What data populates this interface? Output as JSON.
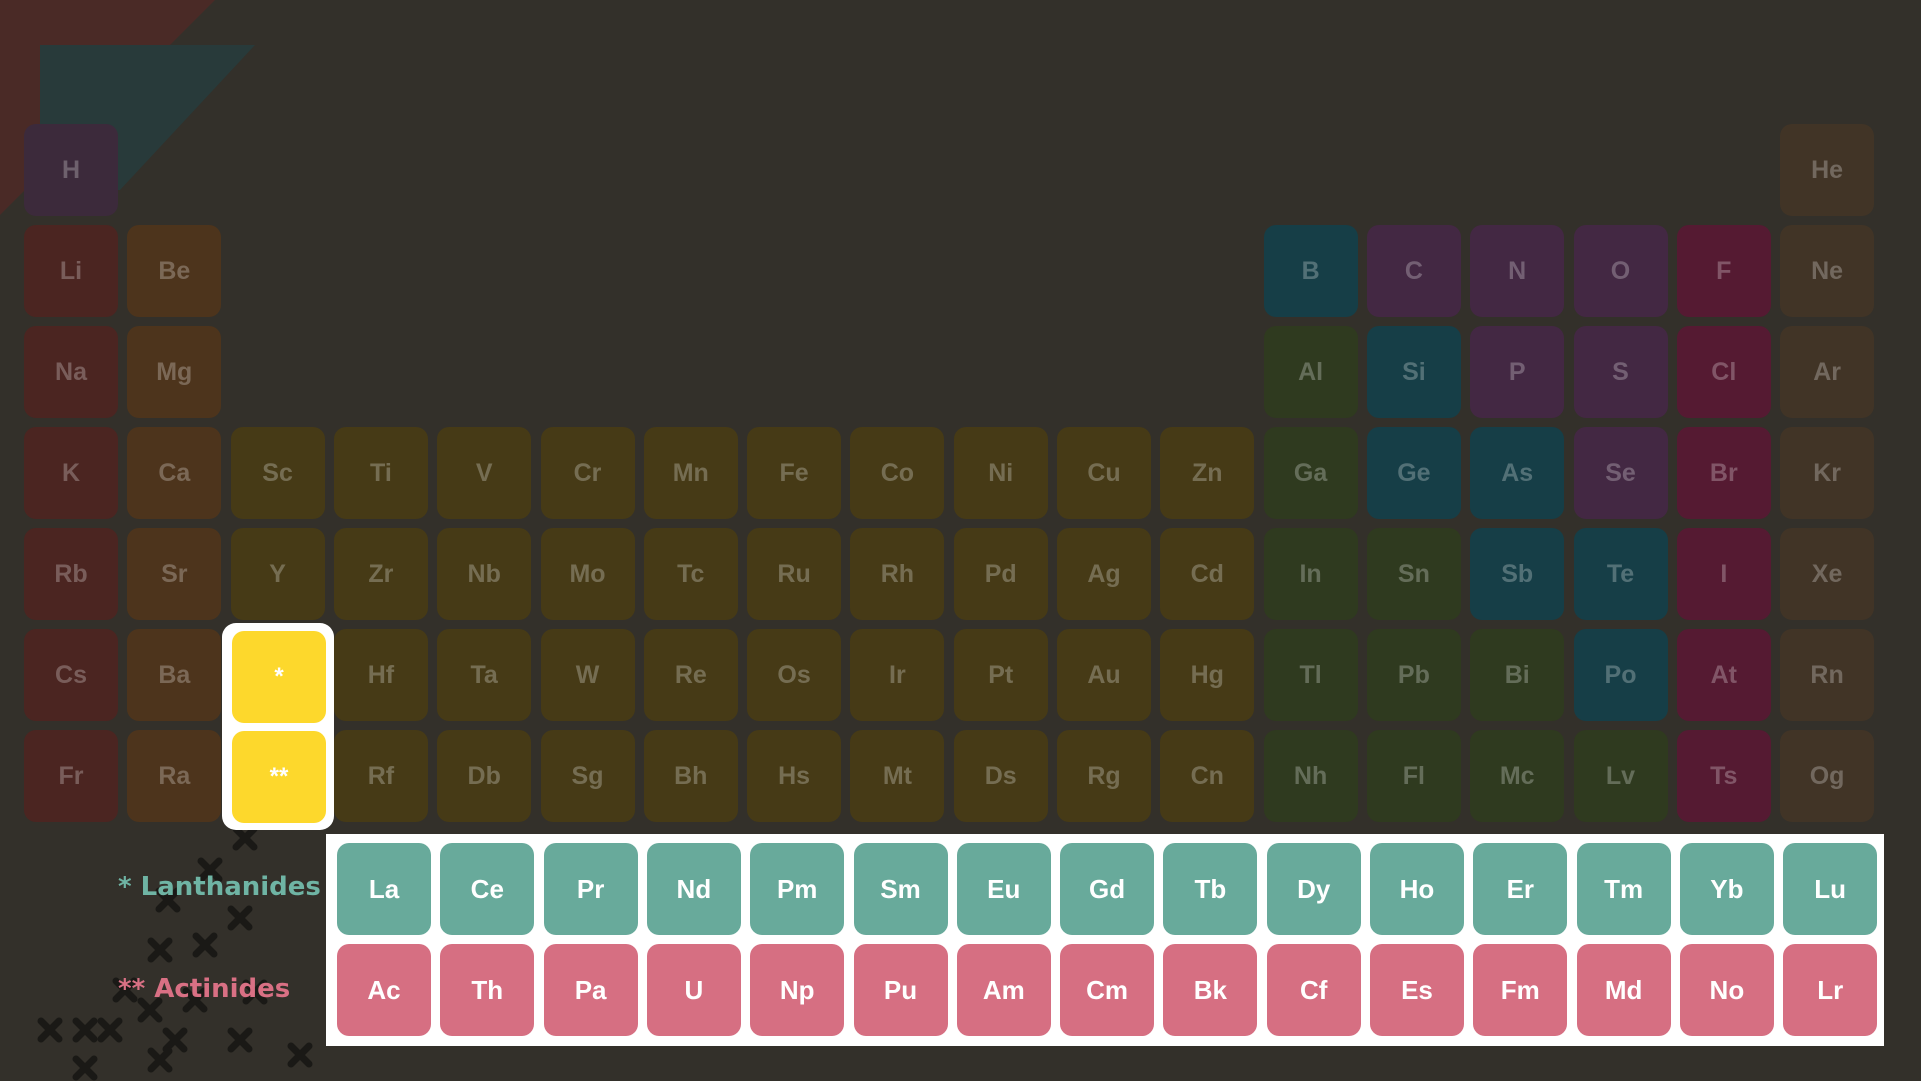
{
  "colors": {
    "background": "#33302a",
    "hydrogen": "#3c2a3b",
    "alkali_metal": "#4b2521",
    "alkaline_earth_metal": "#4d341c",
    "transition_metal": "#463a16",
    "post_transition_metal": "#2f3a1f",
    "metalloid": "#163e47",
    "nonmetal": "#432843",
    "halogen": "#551a32",
    "noble_gas": "#413426",
    "placeholder": "#fdd82c",
    "lanthanide": "#68aa9b",
    "actinide": "#d66f82"
  },
  "main_table": {
    "elements": [
      {
        "symbol": "H",
        "category": "hydrogen",
        "period": 1,
        "group": 1
      },
      {
        "symbol": "He",
        "category": "noble_gas",
        "period": 1,
        "group": 18
      },
      {
        "symbol": "Li",
        "category": "alkali_metal",
        "period": 2,
        "group": 1
      },
      {
        "symbol": "Be",
        "category": "alkaline_earth_metal",
        "period": 2,
        "group": 2
      },
      {
        "symbol": "B",
        "category": "metalloid",
        "period": 2,
        "group": 13
      },
      {
        "symbol": "C",
        "category": "nonmetal",
        "period": 2,
        "group": 14
      },
      {
        "symbol": "N",
        "category": "nonmetal",
        "period": 2,
        "group": 15
      },
      {
        "symbol": "O",
        "category": "nonmetal",
        "period": 2,
        "group": 16
      },
      {
        "symbol": "F",
        "category": "halogen",
        "period": 2,
        "group": 17
      },
      {
        "symbol": "Ne",
        "category": "noble_gas",
        "period": 2,
        "group": 18
      },
      {
        "symbol": "Na",
        "category": "alkali_metal",
        "period": 3,
        "group": 1
      },
      {
        "symbol": "Mg",
        "category": "alkaline_earth_metal",
        "period": 3,
        "group": 2
      },
      {
        "symbol": "Al",
        "category": "post_transition_metal",
        "period": 3,
        "group": 13
      },
      {
        "symbol": "Si",
        "category": "metalloid",
        "period": 3,
        "group": 14
      },
      {
        "symbol": "P",
        "category": "nonmetal",
        "period": 3,
        "group": 15
      },
      {
        "symbol": "S",
        "category": "nonmetal",
        "period": 3,
        "group": 16
      },
      {
        "symbol": "Cl",
        "category": "halogen",
        "period": 3,
        "group": 17
      },
      {
        "symbol": "Ar",
        "category": "noble_gas",
        "period": 3,
        "group": 18
      },
      {
        "symbol": "K",
        "category": "alkali_metal",
        "period": 4,
        "group": 1
      },
      {
        "symbol": "Ca",
        "category": "alkaline_earth_metal",
        "period": 4,
        "group": 2
      },
      {
        "symbol": "Sc",
        "category": "transition_metal",
        "period": 4,
        "group": 3
      },
      {
        "symbol": "Ti",
        "category": "transition_metal",
        "period": 4,
        "group": 4
      },
      {
        "symbol": "V",
        "category": "transition_metal",
        "period": 4,
        "group": 5
      },
      {
        "symbol": "Cr",
        "category": "transition_metal",
        "period": 4,
        "group": 6
      },
      {
        "symbol": "Mn",
        "category": "transition_metal",
        "period": 4,
        "group": 7
      },
      {
        "symbol": "Fe",
        "category": "transition_metal",
        "period": 4,
        "group": 8
      },
      {
        "symbol": "Co",
        "category": "transition_metal",
        "period": 4,
        "group": 9
      },
      {
        "symbol": "Ni",
        "category": "transition_metal",
        "period": 4,
        "group": 10
      },
      {
        "symbol": "Cu",
        "category": "transition_metal",
        "period": 4,
        "group": 11
      },
      {
        "symbol": "Zn",
        "category": "transition_metal",
        "period": 4,
        "group": 12
      },
      {
        "symbol": "Ga",
        "category": "post_transition_metal",
        "period": 4,
        "group": 13
      },
      {
        "symbol": "Ge",
        "category": "metalloid",
        "period": 4,
        "group": 14
      },
      {
        "symbol": "As",
        "category": "metalloid",
        "period": 4,
        "group": 15
      },
      {
        "symbol": "Se",
        "category": "nonmetal",
        "period": 4,
        "group": 16
      },
      {
        "symbol": "Br",
        "category": "halogen",
        "period": 4,
        "group": 17
      },
      {
        "symbol": "Kr",
        "category": "noble_gas",
        "period": 4,
        "group": 18
      },
      {
        "symbol": "Rb",
        "category": "alkali_metal",
        "period": 5,
        "group": 1
      },
      {
        "symbol": "Sr",
        "category": "alkaline_earth_metal",
        "period": 5,
        "group": 2
      },
      {
        "symbol": "Y",
        "category": "transition_metal",
        "period": 5,
        "group": 3
      },
      {
        "symbol": "Zr",
        "category": "transition_metal",
        "period": 5,
        "group": 4
      },
      {
        "symbol": "Nb",
        "category": "transition_metal",
        "period": 5,
        "group": 5
      },
      {
        "symbol": "Mo",
        "category": "transition_metal",
        "period": 5,
        "group": 6
      },
      {
        "symbol": "Tc",
        "category": "transition_metal",
        "period": 5,
        "group": 7
      },
      {
        "symbol": "Ru",
        "category": "transition_metal",
        "period": 5,
        "group": 8
      },
      {
        "symbol": "Rh",
        "category": "transition_metal",
        "period": 5,
        "group": 9
      },
      {
        "symbol": "Pd",
        "category": "transition_metal",
        "period": 5,
        "group": 10
      },
      {
        "symbol": "Ag",
        "category": "transition_metal",
        "period": 5,
        "group": 11
      },
      {
        "symbol": "Cd",
        "category": "transition_metal",
        "period": 5,
        "group": 12
      },
      {
        "symbol": "In",
        "category": "post_transition_metal",
        "period": 5,
        "group": 13
      },
      {
        "symbol": "Sn",
        "category": "post_transition_metal",
        "period": 5,
        "group": 14
      },
      {
        "symbol": "Sb",
        "category": "metalloid",
        "period": 5,
        "group": 15
      },
      {
        "symbol": "Te",
        "category": "metalloid",
        "period": 5,
        "group": 16
      },
      {
        "symbol": "I",
        "category": "halogen",
        "period": 5,
        "group": 17
      },
      {
        "symbol": "Xe",
        "category": "noble_gas",
        "period": 5,
        "group": 18
      },
      {
        "symbol": "Cs",
        "category": "alkali_metal",
        "period": 6,
        "group": 1
      },
      {
        "symbol": "Ba",
        "category": "alkaline_earth_metal",
        "period": 6,
        "group": 2
      },
      {
        "symbol": "Hf",
        "category": "transition_metal",
        "period": 6,
        "group": 4
      },
      {
        "symbol": "Ta",
        "category": "transition_metal",
        "period": 6,
        "group": 5
      },
      {
        "symbol": "W",
        "category": "transition_metal",
        "period": 6,
        "group": 6
      },
      {
        "symbol": "Re",
        "category": "transition_metal",
        "period": 6,
        "group": 7
      },
      {
        "symbol": "Os",
        "category": "transition_metal",
        "period": 6,
        "group": 8
      },
      {
        "symbol": "Ir",
        "category": "transition_metal",
        "period": 6,
        "group": 9
      },
      {
        "symbol": "Pt",
        "category": "transition_metal",
        "period": 6,
        "group": 10
      },
      {
        "symbol": "Au",
        "category": "transition_metal",
        "period": 6,
        "group": 11
      },
      {
        "symbol": "Hg",
        "category": "transition_metal",
        "period": 6,
        "group": 12
      },
      {
        "symbol": "Tl",
        "category": "post_transition_metal",
        "period": 6,
        "group": 13
      },
      {
        "symbol": "Pb",
        "category": "post_transition_metal",
        "period": 6,
        "group": 14
      },
      {
        "symbol": "Bi",
        "category": "post_transition_metal",
        "period": 6,
        "group": 15
      },
      {
        "symbol": "Po",
        "category": "metalloid",
        "period": 6,
        "group": 16
      },
      {
        "symbol": "At",
        "category": "halogen",
        "period": 6,
        "group": 17
      },
      {
        "symbol": "Rn",
        "category": "noble_gas",
        "period": 6,
        "group": 18
      },
      {
        "symbol": "Fr",
        "category": "alkali_metal",
        "period": 7,
        "group": 1
      },
      {
        "symbol": "Ra",
        "category": "alkaline_earth_metal",
        "period": 7,
        "group": 2
      },
      {
        "symbol": "Rf",
        "category": "transition_metal",
        "period": 7,
        "group": 4
      },
      {
        "symbol": "Db",
        "category": "transition_metal",
        "period": 7,
        "group": 5
      },
      {
        "symbol": "Sg",
        "category": "transition_metal",
        "period": 7,
        "group": 6
      },
      {
        "symbol": "Bh",
        "category": "transition_metal",
        "period": 7,
        "group": 7
      },
      {
        "symbol": "Hs",
        "category": "transition_metal",
        "period": 7,
        "group": 8
      },
      {
        "symbol": "Mt",
        "category": "transition_metal",
        "period": 7,
        "group": 9
      },
      {
        "symbol": "Ds",
        "category": "transition_metal",
        "period": 7,
        "group": 10
      },
      {
        "symbol": "Rg",
        "category": "transition_metal",
        "period": 7,
        "group": 11
      },
      {
        "symbol": "Cn",
        "category": "transition_metal",
        "period": 7,
        "group": 12
      },
      {
        "symbol": "Nh",
        "category": "post_transition_metal",
        "period": 7,
        "group": 13
      },
      {
        "symbol": "Fl",
        "category": "post_transition_metal",
        "period": 7,
        "group": 14
      },
      {
        "symbol": "Mc",
        "category": "post_transition_metal",
        "period": 7,
        "group": 15
      },
      {
        "symbol": "Lv",
        "category": "post_transition_metal",
        "period": 7,
        "group": 16
      },
      {
        "symbol": "Ts",
        "category": "halogen",
        "period": 7,
        "group": 17
      },
      {
        "symbol": "Og",
        "category": "noble_gas",
        "period": 7,
        "group": 18
      }
    ]
  },
  "placeholders": {
    "lanthanide_marker": "*",
    "actinide_marker": "**"
  },
  "legend": {
    "lanthanides": "* Lanthanides",
    "actinides": "** Actinides"
  },
  "lanthanides": [
    "La",
    "Ce",
    "Pr",
    "Nd",
    "Pm",
    "Sm",
    "Eu",
    "Gd",
    "Tb",
    "Dy",
    "Ho",
    "Er",
    "Tm",
    "Yb",
    "Lu"
  ],
  "actinides": [
    "Ac",
    "Th",
    "Pa",
    "U",
    "Np",
    "Pu",
    "Am",
    "Cm",
    "Bk",
    "Cf",
    "Es",
    "Fm",
    "Md",
    "No",
    "Lr"
  ]
}
